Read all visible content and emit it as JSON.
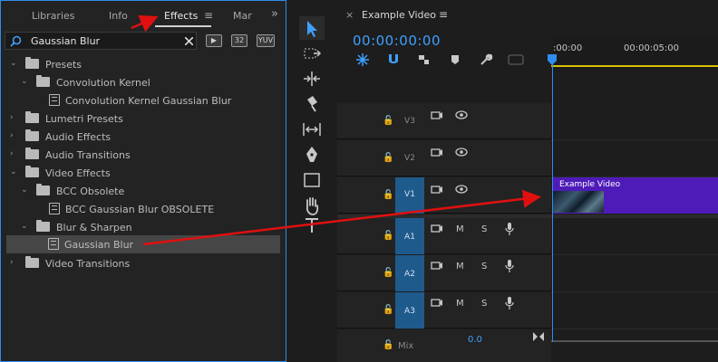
{
  "effects_panel": {
    "tabs": [
      {
        "label": "Libraries"
      },
      {
        "label": "Info"
      },
      {
        "label": "Effects"
      },
      {
        "label": "Mar"
      }
    ],
    "overflow": "»",
    "menu_icon": "≡",
    "search": {
      "value": "Gaussian Blur"
    },
    "filter_buttons": [
      {
        "label": "32"
      },
      {
        "label": "YUV"
      }
    ],
    "tree": [
      {
        "label": "Presets"
      },
      {
        "label": "Convolution Kernel"
      },
      {
        "label": "Convolution Kernel Gaussian Blur"
      },
      {
        "label": "Lumetri Presets"
      },
      {
        "label": "Audio Effects"
      },
      {
        "label": "Audio Transitions"
      },
      {
        "label": "Video Effects"
      },
      {
        "label": "BCC Obsolete"
      },
      {
        "label": "BCC Gaussian Blur OBSOLETE"
      },
      {
        "label": "Blur & Sharpen"
      },
      {
        "label": "Gaussian Blur"
      },
      {
        "label": "Video Transitions"
      }
    ]
  },
  "timeline": {
    "close": "×",
    "title": "Example Video",
    "menu_icon": "≡",
    "timecode": "00:00:00:00",
    "ruler": [
      ":00:00",
      "00:00:05:00"
    ],
    "tracks": {
      "video": [
        {
          "name": "V3"
        },
        {
          "name": "V2"
        },
        {
          "name": "V1"
        }
      ],
      "audio": [
        {
          "name": "A1",
          "m": "M",
          "s": "S"
        },
        {
          "name": "A2",
          "m": "M",
          "s": "S"
        },
        {
          "name": "A3",
          "m": "M",
          "s": "S"
        }
      ],
      "mix_label": "Mix",
      "mix_value": "0.0"
    },
    "clip": {
      "label": "Example Video"
    }
  },
  "colors": {
    "accent_blue": "#2d8ceb",
    "clip_purple": "#4e1bb8",
    "arrow_red": "#e01010"
  }
}
